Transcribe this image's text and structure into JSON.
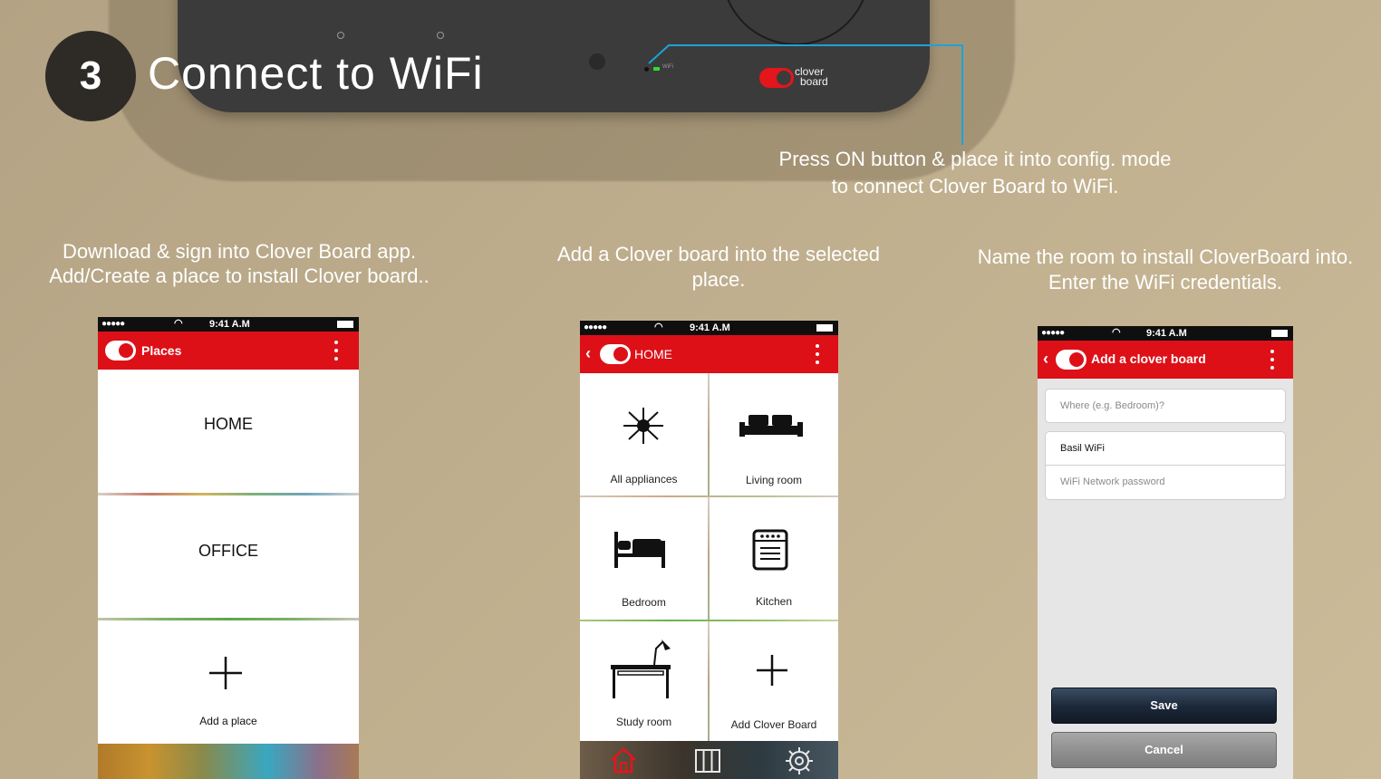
{
  "step": {
    "number": "3",
    "title": "Connect to WiFi"
  },
  "device": {
    "wifi_label": "WiFi",
    "logo_line1": "clover",
    "logo_line2": "board"
  },
  "captions": {
    "device_line1": "Press ON button & place it into config. mode",
    "device_line2": "to connect Clover Board to WiFi.",
    "left_line1": "Download & sign into Clover Board app.",
    "left_line2": "Add/Create a place to install Clover board..",
    "middle_line1": "Add a Clover board into the selected",
    "middle_line2": "place.",
    "right_line1": "Name the room to install CloverBoard into.",
    "right_line2": "Enter the WiFi  credentials."
  },
  "status_bar": {
    "dots": "●●●●●",
    "time": "9:41 A.M",
    "wifi_symbol": "wifi-icon",
    "battery": "battery-icon"
  },
  "phone_places": {
    "title": "Places",
    "items": [
      "HOME",
      "OFFICE"
    ],
    "add_label": "Add a place"
  },
  "phone_home": {
    "title": "HOME",
    "rooms": [
      {
        "label": "All appliances",
        "icon": "light-burst-icon"
      },
      {
        "label": "Living room",
        "icon": "sofa-icon"
      },
      {
        "label": "Bedroom",
        "icon": "bed-icon"
      },
      {
        "label": "Kitchen",
        "icon": "stove-icon"
      },
      {
        "label": "Study room",
        "icon": "desk-lamp-icon"
      },
      {
        "label": "Add Clover Board",
        "icon": "plus-icon"
      }
    ],
    "nav": [
      "home-icon",
      "grid-icon",
      "settings-icon"
    ]
  },
  "phone_add": {
    "title": "Add a clover board",
    "where_placeholder": "Where (e.g. Bedroom)?",
    "wifi_name": "Basil WiFi",
    "wifi_password_placeholder": "WiFi Network password",
    "save_label": "Save",
    "cancel_label": "Cancel"
  },
  "colors": {
    "app_red": "#dd1018",
    "callout_blue": "#1aa3d9",
    "background": "#bfae8d"
  }
}
